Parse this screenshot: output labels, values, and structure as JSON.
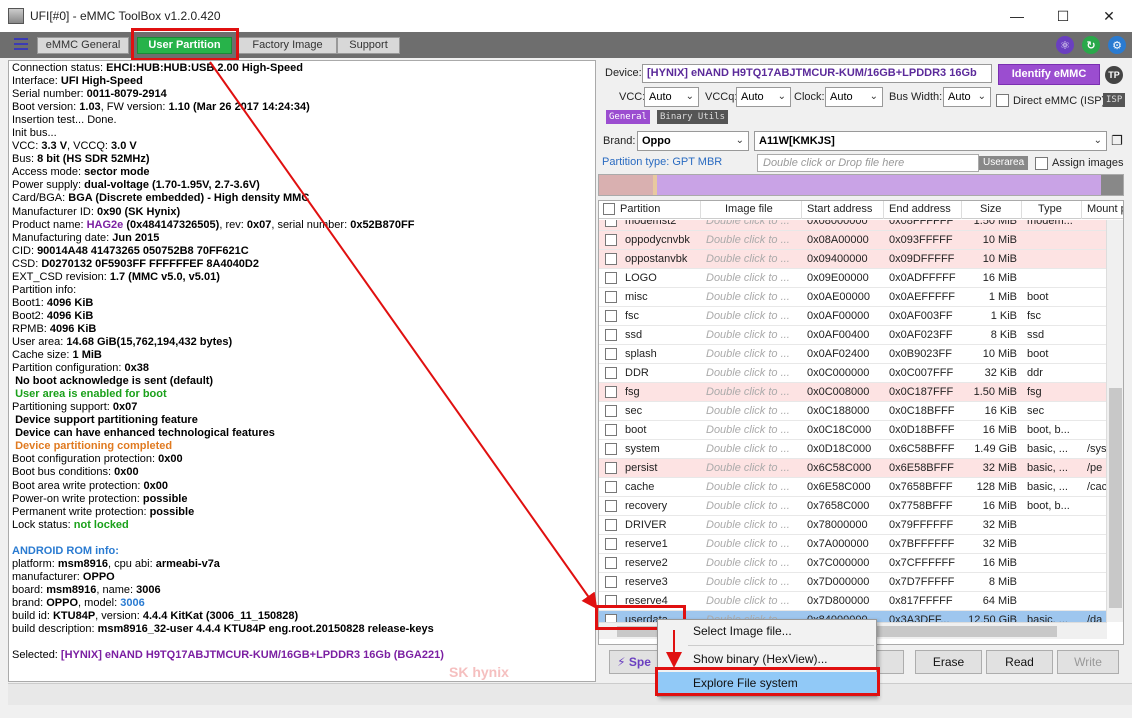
{
  "window": {
    "title": "UFI[#0] - eMMC ToolBox v1.2.0.420",
    "minimize": "—",
    "maximize": "☐",
    "close": "✕"
  },
  "tabs": [
    {
      "label": "eMMC General",
      "active": false
    },
    {
      "label": "User Partition",
      "active": true
    },
    {
      "label": "Factory Image",
      "active": false
    },
    {
      "label": "Support",
      "active": false
    }
  ],
  "log": {
    "connection_status": "EHCI:HUB:HUB:USB 2.00 High-Speed",
    "interface": "UFI High-Speed",
    "serial_number": "0011-8079-2914",
    "boot_version": "1.03",
    "fw_version": "1.10 (Mar 26 2017 14:24:34)",
    "insertion_test": "Insertion test... Done.",
    "init_bus": "Init bus...",
    "vcc": "3.3 V",
    "vccq": "3.0 V",
    "bus": "8 bit (HS SDR 52MHz)",
    "access_mode": "sector mode",
    "power_supply": "dual-voltage (1.70-1.95V, 2.7-3.6V)",
    "card_bga": "BGA (Discrete embedded) - High density MMC",
    "manufacturer_id": "0x90 (SK Hynix)",
    "product_name": "HAG2e",
    "product_id": "(0x484147326505)",
    "rev": "0x07",
    "serial_number_hex": "0x52B870FF",
    "manufacturing_date": "Jun 2015",
    "cid": "90014A48 41473265 050752B8 70FF621C",
    "csd": "D0270132 0F5903FF FFFFFFEF 8A4040D2",
    "ext_csd_revision": "1.7 (MMC v5.0, v5.01)",
    "partition_info": "Partition info:",
    "boot1": "4096 KiB",
    "boot2": "4096 KiB",
    "rpmb": "4096 KiB",
    "user_area": "14.68 GiB(15,762,194,432 bytes)",
    "cache_size": "1 MiB",
    "partition_configuration": "0x38",
    "no_boot_ack": "No boot acknowledge is sent (default)",
    "user_area_boot": "User area is enabled for boot",
    "partitioning_support": "0x07",
    "device_support_partitioning": "Device support partitioning feature",
    "enhanced_features": "Device can have enhanced technological features",
    "partitioning_completed": "Device partitioning completed",
    "boot_config_protection": "0x00",
    "boot_bus_conditions": "0x00",
    "boot_area_write_protection": "0x00",
    "power_on_write_protection": "possible",
    "permanent_write_protection": "possible",
    "lock_status": "not locked",
    "android_header": "ANDROID ROM info:",
    "platform": "msm8916",
    "cpu_abi": "armeabi-v7a",
    "manufacturer": "OPPO",
    "board": "msm8916",
    "name": "3006",
    "brand": "OPPO",
    "model": "3006",
    "build_id": "KTU84P",
    "version": "4.4.4 KitKat (3006_11_150828)",
    "build_description": "msm8916_32-user 4.4.4 KTU84P eng.root.20150828 release-keys",
    "selected": "[HYNIX] eNAND H9TQ17ABJTMCUR-KUM/16GB+LPDDR3 16Gb",
    "selected_pkg": "(BGA221)",
    "watermark": "SK hynix"
  },
  "labels": {
    "connection_status": "Connection status: ",
    "interface": "Interface: ",
    "serial_number": "Serial number: ",
    "boot_version": " Boot version: ",
    "fw_version": ", FW version: ",
    "vcc": "VCC: ",
    "vccq": ", VCCQ: ",
    "bus": "Bus: ",
    "access_mode": "Access mode: ",
    "power_supply": "Power supply: ",
    "card_bga": " Card/BGA: ",
    "manufacturer_id": " Manufacturer ID: ",
    "product_name": " Product name: ",
    "rev": ", rev: ",
    "serial_number_hex": ", serial number: ",
    "manufacturing_date": " Manufacturing date: ",
    "cid": "CID: ",
    "csd": "CSD: ",
    "ext_csd_revision": "EXT_CSD revision: ",
    "boot1": " Boot1: ",
    "boot2": " Boot2: ",
    "rpmb": " RPMB: ",
    "user_area": " User area: ",
    "cache_size": "Cache size: ",
    "partition_configuration": "Partition configuration: ",
    "partitioning_support": "Partitioning support: ",
    "boot_config_protection": "Boot configuration protection: ",
    "boot_bus_conditions": "Boot bus conditions: ",
    "boot_area_write_protection": "Boot area write protection: ",
    "power_on_write_protection": " Power-on write protection: ",
    "permanent_write_protection": " Permanent write protection: ",
    "lock_status": " Lock status: ",
    "platform": " platform: ",
    "cpu_abi": ", cpu abi: ",
    "manufacturer": " manufacturer: ",
    "board": " board: ",
    "name": ", name: ",
    "brand": " brand: ",
    "model": ", model: ",
    "build_id": " build id: ",
    "version": ", version: ",
    "build_description": " build description: ",
    "selected": "Selected: "
  },
  "right": {
    "device_label": "Device:",
    "device_value": "[HYNIX] eNAND H9TQ17ABJTMCUR-KUM/16GB+LPDDR3 16Gb",
    "identify_button": "Identify eMMC",
    "tp_icon": "TP",
    "vcc_label": "VCC:",
    "vcc_value": "Auto",
    "vccq_label": "VCCq:",
    "vccq_value": "Auto",
    "clock_label": "Clock:",
    "clock_value": "Auto",
    "bus_width_label": "Bus Width:",
    "bus_width_value": "Auto",
    "direct_emmc_label": "Direct eMMC (ISP)",
    "isp_icon": "ISP",
    "subtab_general": "General",
    "subtab_binary": "Binary Utils",
    "brand_label": "Brand:",
    "brand_value": "Oppo",
    "model_value": "A11W[KMKJS]",
    "partition_type": "Partition type: GPT MBR",
    "drop_placeholder": "Double click or Drop file here",
    "userarea_tag": "Userarea",
    "assign_images_label": "Assign images"
  },
  "table": {
    "headers": [
      "Partition",
      "Image file",
      "Start address",
      "End address",
      "Size",
      "Type",
      "Mount p"
    ],
    "rows": [
      {
        "name": "modemst2",
        "img": "Double click to ...",
        "start": "0x08000000",
        "end": "0x08FFFFFF",
        "size": "1.50 MiB",
        "type": "modem...",
        "mount": "",
        "style": "pink"
      },
      {
        "name": "oppodycnvbk",
        "img": "Double click to ...",
        "start": "0x08A00000",
        "end": "0x093FFFFF",
        "size": "10 MiB",
        "type": "",
        "mount": "",
        "style": "pink"
      },
      {
        "name": "oppostanvbk",
        "img": "Double click to ...",
        "start": "0x09400000",
        "end": "0x09DFFFFF",
        "size": "10 MiB",
        "type": "",
        "mount": "",
        "style": "pink"
      },
      {
        "name": "LOGO",
        "img": "Double click to ...",
        "start": "0x09E00000",
        "end": "0x0ADFFFFF",
        "size": "16 MiB",
        "type": "",
        "mount": "",
        "style": ""
      },
      {
        "name": "misc",
        "img": "Double click to ...",
        "start": "0x0AE00000",
        "end": "0x0AEFFFFF",
        "size": "1 MiB",
        "type": "boot",
        "mount": "",
        "style": ""
      },
      {
        "name": "fsc",
        "img": "Double click to ...",
        "start": "0x0AF00000",
        "end": "0x0AF003FF",
        "size": "1 KiB",
        "type": "fsc",
        "mount": "",
        "style": ""
      },
      {
        "name": "ssd",
        "img": "Double click to ...",
        "start": "0x0AF00400",
        "end": "0x0AF023FF",
        "size": "8 KiB",
        "type": "ssd",
        "mount": "",
        "style": ""
      },
      {
        "name": "splash",
        "img": "Double click to ...",
        "start": "0x0AF02400",
        "end": "0x0B9023FF",
        "size": "10 MiB",
        "type": "boot",
        "mount": "",
        "style": ""
      },
      {
        "name": "DDR",
        "img": "Double click to ...",
        "start": "0x0C000000",
        "end": "0x0C007FFF",
        "size": "32 KiB",
        "type": "ddr",
        "mount": "",
        "style": ""
      },
      {
        "name": "fsg",
        "img": "Double click to ...",
        "start": "0x0C008000",
        "end": "0x0C187FFF",
        "size": "1.50 MiB",
        "type": "fsg",
        "mount": "",
        "style": "pink"
      },
      {
        "name": "sec",
        "img": "Double click to ...",
        "start": "0x0C188000",
        "end": "0x0C18BFFF",
        "size": "16 KiB",
        "type": "sec",
        "mount": "",
        "style": ""
      },
      {
        "name": "boot",
        "img": "Double click to ...",
        "start": "0x0C18C000",
        "end": "0x0D18BFFF",
        "size": "16 MiB",
        "type": "boot, b...",
        "mount": "",
        "style": ""
      },
      {
        "name": "system",
        "img": "Double click to ...",
        "start": "0x0D18C000",
        "end": "0x6C58BFFF",
        "size": "1.49 GiB",
        "type": "basic, ...",
        "mount": "/sys",
        "style": ""
      },
      {
        "name": "persist",
        "img": "Double click to ...",
        "start": "0x6C58C000",
        "end": "0x6E58BFFF",
        "size": "32 MiB",
        "type": "basic, ...",
        "mount": "/pe",
        "style": "pink"
      },
      {
        "name": "cache",
        "img": "Double click to ...",
        "start": "0x6E58C000",
        "end": "0x7658BFFF",
        "size": "128 MiB",
        "type": "basic, ...",
        "mount": "/cac",
        "style": ""
      },
      {
        "name": "recovery",
        "img": "Double click to ...",
        "start": "0x7658C000",
        "end": "0x7758BFFF",
        "size": "16 MiB",
        "type": "boot, b...",
        "mount": "",
        "style": ""
      },
      {
        "name": "DRIVER",
        "img": "Double click to ...",
        "start": "0x78000000",
        "end": "0x79FFFFFF",
        "size": "32 MiB",
        "type": "",
        "mount": "",
        "style": ""
      },
      {
        "name": "reserve1",
        "img": "Double click to ...",
        "start": "0x7A000000",
        "end": "0x7BFFFFFF",
        "size": "32 MiB",
        "type": "",
        "mount": "",
        "style": ""
      },
      {
        "name": "reserve2",
        "img": "Double click to ...",
        "start": "0x7C000000",
        "end": "0x7CFFFFFF",
        "size": "16 MiB",
        "type": "",
        "mount": "",
        "style": ""
      },
      {
        "name": "reserve3",
        "img": "Double click to ...",
        "start": "0x7D000000",
        "end": "0x7D7FFFFF",
        "size": "8 MiB",
        "type": "",
        "mount": "",
        "style": ""
      },
      {
        "name": "reserve4",
        "img": "Double click to ...",
        "start": "0x7D800000",
        "end": "0x817FFFFF",
        "size": "64 MiB",
        "type": "",
        "mount": "",
        "style": ""
      },
      {
        "name": "userdata",
        "img": "Double click to ...",
        "start": "0x84000000",
        "end": "0x3A3DFF...",
        "size": "12.50 GiB",
        "type": "basic, ...",
        "mount": "/da",
        "style": "selected"
      }
    ]
  },
  "buttons": {
    "speed": "Spe",
    "hidden_btn": "y",
    "erase": "Erase",
    "read": "Read",
    "write": "Write"
  },
  "context_menu": {
    "items": [
      "Select Image file...",
      "Show binary (HexView)...",
      "Explore File system"
    ]
  },
  "colors": {
    "active_tab": "#27b34a",
    "accent_purple": "#9b4dd0",
    "highlight_red": "#e01010",
    "selected_row": "#9ec6ee"
  }
}
